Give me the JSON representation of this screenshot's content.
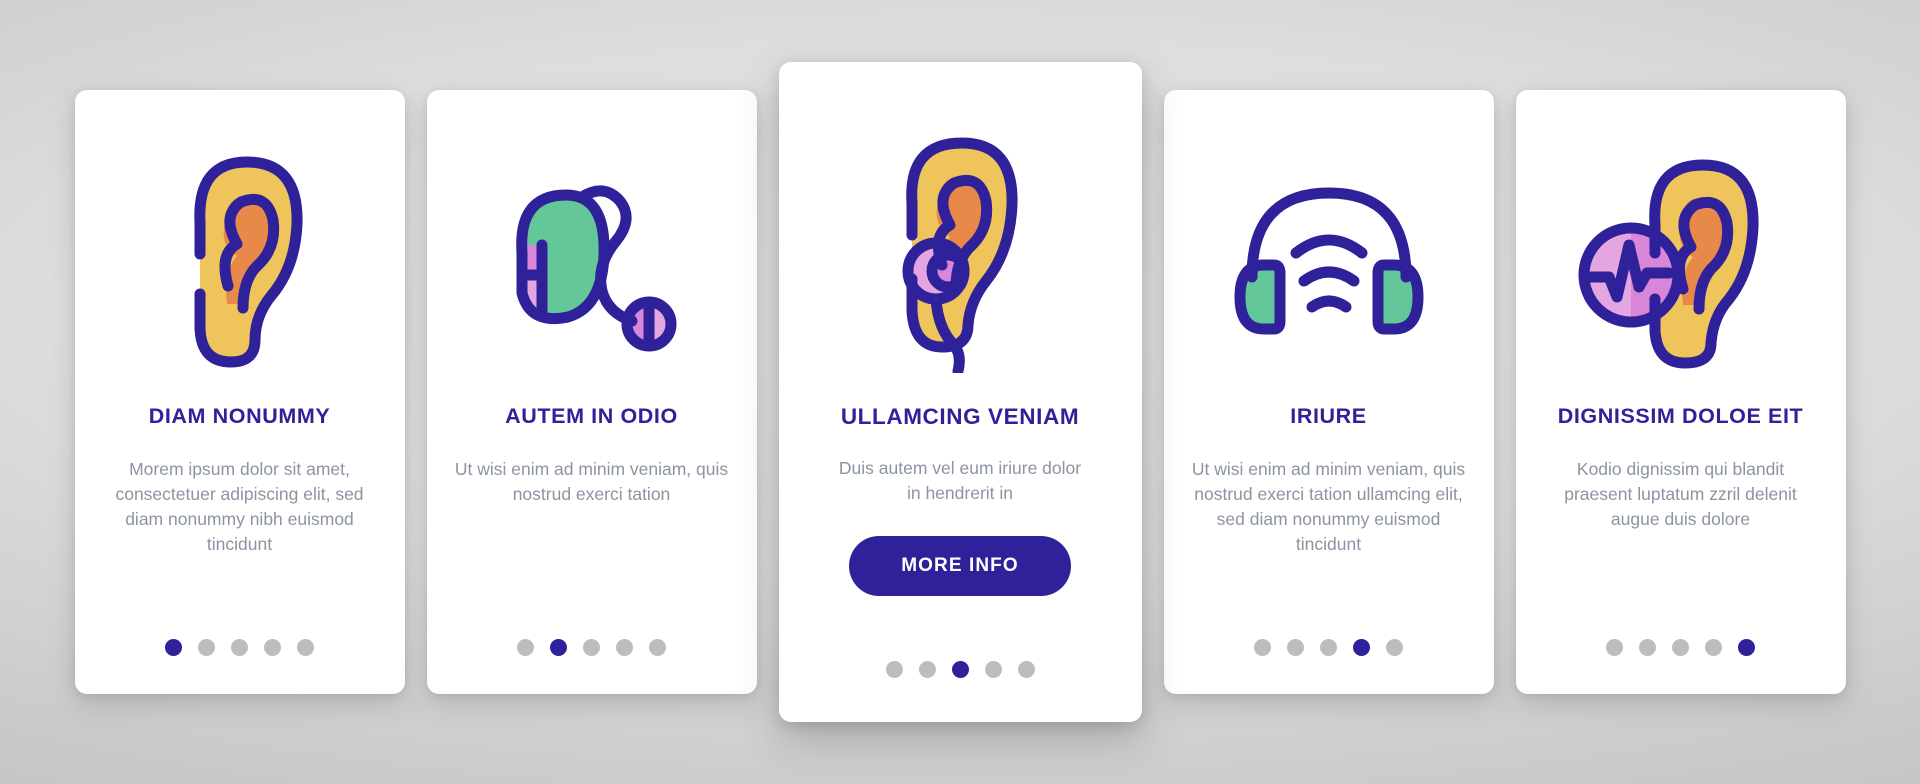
{
  "theme": {
    "primary": "#2e219a",
    "body_text": "#8c94a3",
    "card_bg": "#ffffff",
    "dot_inactive": "#bdbdbd",
    "ear_fill": "#eec45b",
    "ear_inner_fill": "#e8894a",
    "device_green": "#63c799",
    "device_pink": "#d886d8",
    "device_pink_light": "#e3a6e0"
  },
  "cards": [
    {
      "icon": "ear-icon",
      "title": "DIAM NONUMMY",
      "body": "Morem ipsum dolor sit amet, consectetuer adipiscing elit, sed diam nonummy nibh euismod tincidunt",
      "dots": {
        "count": 5,
        "active": 1
      },
      "featured": false,
      "cta": null
    },
    {
      "icon": "hearing-aid-icon",
      "title": "AUTEM IN ODIO",
      "body": "Ut wisi enim ad minim veniam, quis nostrud exerci tation",
      "dots": {
        "count": 5,
        "active": 2
      },
      "featured": false,
      "cta": null
    },
    {
      "icon": "ear-with-in-ear-device-icon",
      "title": "ULLAMCING VENIAM",
      "body": "Duis autem vel eum iriure dolor in hendrerit in",
      "dots": {
        "count": 5,
        "active": 3
      },
      "featured": true,
      "cta": "MORE INFO"
    },
    {
      "icon": "headphones-sound-waves-icon",
      "title": "IRIURE",
      "body": "Ut wisi enim ad minim veniam, quis nostrud exerci tation ullamcing elit, sed diam nonummy euismod tincidunt",
      "dots": {
        "count": 5,
        "active": 4
      },
      "featured": false,
      "cta": null
    },
    {
      "icon": "ear-with-audiogram-icon",
      "title": "DIGNISSIM DOLOE EIT",
      "body": "Kodio dignissim qui blandit praesent luptatum zzril delenit augue duis dolore",
      "dots": {
        "count": 5,
        "active": 5
      },
      "featured": false,
      "cta": null
    }
  ]
}
